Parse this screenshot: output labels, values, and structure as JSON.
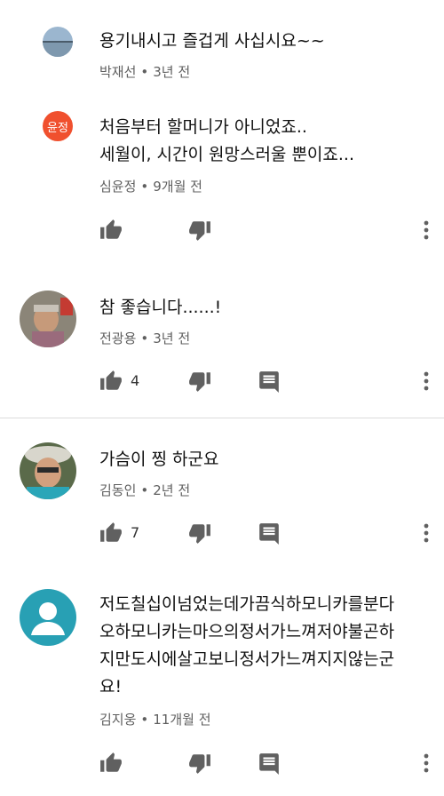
{
  "comments": [
    {
      "text": "용기내시고 즐겁게 사십시요~~",
      "author": "박재선",
      "time": "3년 전"
    },
    {
      "avatar_initials": "윤정",
      "lines": [
        "처음부터 할머니가 아니었죠..",
        "세월이, 시간이 원망스러울 뿐이죠..."
      ],
      "author": "심윤정",
      "time": "9개월 전"
    },
    {
      "text": "참 좋습니다......!",
      "author": "전광용",
      "time": "3년 전",
      "likes": "4"
    },
    {
      "text": "가슴이 찡 하군요",
      "author": "김동인",
      "time": "2년 전",
      "likes": "7"
    },
    {
      "lines": [
        "저도칠십이넘었는데가끔식하모니카를분다",
        "오하모니카는마으의정서가느껴저야불곤하",
        "지만도시에살고보니정서가느껴지지않는군",
        "요!"
      ],
      "author": "김지웅",
      "time": "11개월 전"
    }
  ],
  "separator": "•",
  "colors": {
    "avatar_initials_bg": "#f0502e",
    "icon": "#606060",
    "divider": "#dcdcdc",
    "default_avatar": "#28a0b4"
  },
  "icons": [
    "thumb-up-icon",
    "thumb-down-icon",
    "reply-icon",
    "more-vert-icon"
  ]
}
